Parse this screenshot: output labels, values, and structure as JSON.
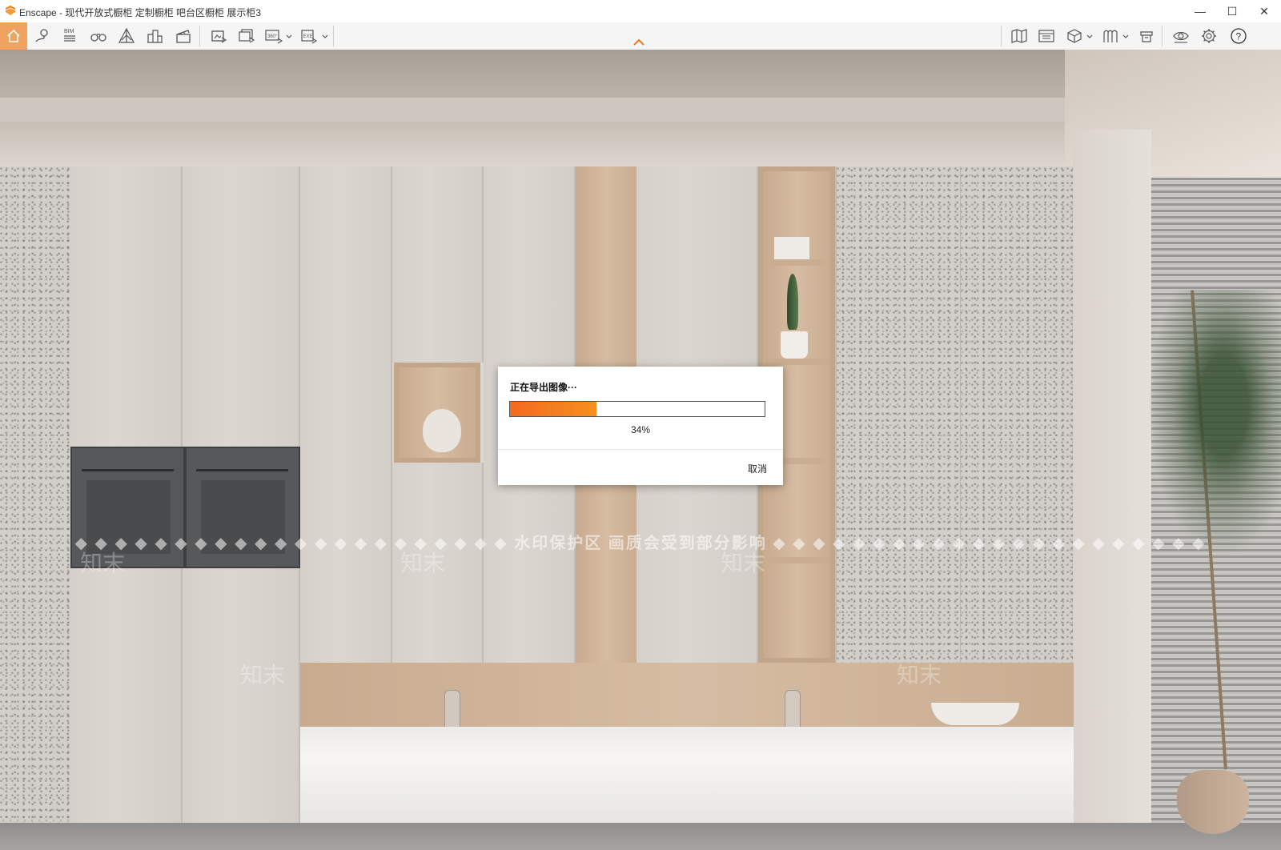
{
  "window": {
    "title": "Enscape - 现代开放式橱柜 定制橱柜  吧台区橱柜 展示柜3",
    "controls": {
      "minimize": "—",
      "maximize": "☐",
      "close": "✕"
    }
  },
  "toolbar": {
    "left_icons": [
      "home-icon",
      "map-pin-icon",
      "bim-icon",
      "binoculars-icon",
      "perspective-icon",
      "buildings-icon",
      "clapper-icon",
      "screenshot-icon",
      "batch-render-icon",
      "panorama-360-icon",
      "export-exe-icon"
    ],
    "right_icons": [
      "map-icon",
      "asset-library-icon",
      "cube-icon",
      "material-icon",
      "visual-settings-icon",
      "eye-icon",
      "gear-icon",
      "help-icon"
    ],
    "bim_label": "BIM",
    "panorama_label": "360°",
    "exe_label": "EXE",
    "help_label": "?",
    "accent": "#f0a35e"
  },
  "scene": {
    "watermark_text": "◆ ◆ ◆ ◆ ◆ ◆ ◆ ◆ ◆ ◆ ◆ ◆ ◆ ◆ ◆ ◆ ◆ ◆ ◆ ◆ ◆ ◆  水印保护区  画质会受到部分影响  ◆ ◆ ◆ ◆ ◆ ◆ ◆ ◆ ◆ ◆ ◆ ◆ ◆ ◆ ◆ ◆ ◆ ◆ ◆ ◆ ◆ ◆",
    "watermark_brand": "知末"
  },
  "dialog": {
    "title": "正在导出图像···",
    "progress": 0.34,
    "progress_text": "34%",
    "cancel_label": "取消",
    "bar_color": "#f26a1f"
  }
}
